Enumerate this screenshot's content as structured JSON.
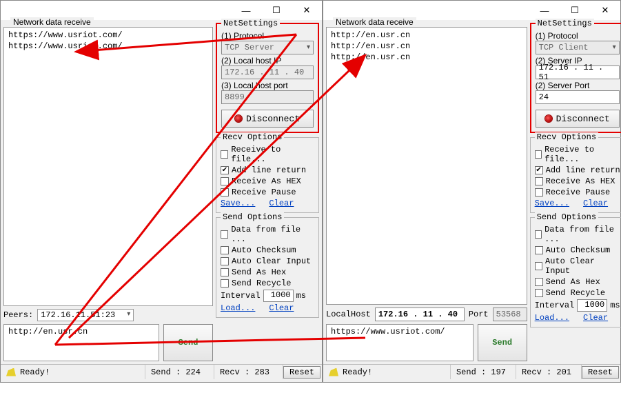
{
  "left": {
    "receive_label": "Network data receive",
    "receive_lines": [
      "https://www.usriot.com/",
      "https://www.usriot.com/"
    ],
    "peers_label": "Peers:",
    "peers_value": "172.16.11.51:23",
    "send_text": "http://en.usr.cn",
    "send_btn": "Send",
    "net": {
      "title": "NetSettings",
      "proto_label": "(1) Protocol",
      "proto_value": "TCP Server",
      "ip_label": "(2) Local host IP",
      "ip_value": "172.16 . 11 . 40",
      "port_label": "(3) Local host port",
      "port_value": "8899",
      "disconnect": "Disconnect"
    },
    "recv_opts": {
      "title": "Recv Options",
      "to_file": "Receive to file...",
      "add_lr": "Add line return",
      "as_hex": "Receive As HEX",
      "pause": "Receive Pause",
      "save": "Save...",
      "clear": "Clear"
    },
    "send_opts": {
      "title": "Send Options",
      "from_file": "Data from file ...",
      "checksum": "Auto Checksum",
      "clear_in": "Auto Clear Input",
      "as_hex": "Send As Hex",
      "recycle": "Send Recycle",
      "interval_lbl": "Interval",
      "interval_val": "1000",
      "interval_unit": "ms",
      "load": "Load...",
      "clear": "Clear"
    },
    "status": {
      "ready": "Ready!",
      "send": "Send : 224",
      "recv": "Recv : 283",
      "reset": "Reset"
    }
  },
  "right": {
    "receive_label": "Network data receive",
    "receive_lines": [
      "http://en.usr.cn",
      "http://en.usr.cn",
      "http://en.usr.cn"
    ],
    "localhost_label": "LocalHost",
    "localhost_value": "172.16 . 11 . 40",
    "port_label": "Port",
    "port_value": "53568",
    "send_text": "https://www.usriot.com/",
    "send_btn": "Send",
    "net": {
      "title": "NetSettings",
      "proto_label": "(1) Protocol",
      "proto_value": "TCP Client",
      "ip_label": "(2) Server IP",
      "ip_value": "172.16 . 11 . 51",
      "port_label": "(2) Server Port",
      "port_value": "24",
      "disconnect": "Disconnect"
    },
    "recv_opts": {
      "title": "Recv Options",
      "to_file": "Receive to file...",
      "add_lr": "Add line return",
      "as_hex": "Receive As HEX",
      "pause": "Receive Pause",
      "save": "Save...",
      "clear": "Clear"
    },
    "send_opts": {
      "title": "Send Options",
      "from_file": "Data from file ...",
      "checksum": "Auto Checksum",
      "clear_in": "Auto Clear Input",
      "as_hex": "Send As Hex",
      "recycle": "Send Recycle",
      "interval_lbl": "Interval",
      "interval_val": "1000",
      "interval_unit": "ms",
      "load": "Load...",
      "clear": "Clear"
    },
    "status": {
      "ready": "Ready!",
      "send": "Send : 197",
      "recv": "Recv : 201",
      "reset": "Reset"
    }
  },
  "icons": {
    "min": "—",
    "max": "☐",
    "close": "✕",
    "check": "✔",
    "chev": "▾"
  }
}
